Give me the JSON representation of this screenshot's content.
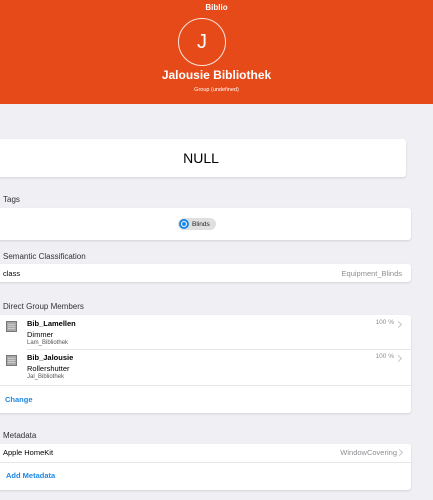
{
  "header": {
    "app_title": "Biblio",
    "avatar_letter": "J",
    "item_label": "Jalousie Bibliothek",
    "item_subtitle": "Group (undefined)"
  },
  "state": {
    "value": "NULL"
  },
  "tags": {
    "section_title": "Tags",
    "chips": [
      {
        "label": "Blinds",
        "icon": "tag-icon"
      }
    ]
  },
  "semantic": {
    "section_title": "Semantic Classification",
    "key": "class",
    "value": "Equipment_Blinds"
  },
  "members": {
    "section_title": "Direct Group Members",
    "items": [
      {
        "label": "Bib_Lamellen",
        "type": "Dimmer",
        "name": "Lam_Bibliothek",
        "state": "100 %",
        "icon": "blinds-icon"
      },
      {
        "label": "Bib_Jalousie",
        "type": "Rollershutter",
        "name": "Jal_Bibliothek",
        "state": "100 %",
        "icon": "blinds-icon"
      }
    ],
    "change_label": "Change"
  },
  "metadata": {
    "section_title": "Metadata",
    "entries": [
      {
        "key": "Apple HomeKit",
        "value": "WindowCovering"
      }
    ],
    "add_label": "Add Metadata"
  },
  "colors": {
    "header_bg": "#e64a19",
    "link": "#1e88e5",
    "page_bg": "#efeff4"
  }
}
